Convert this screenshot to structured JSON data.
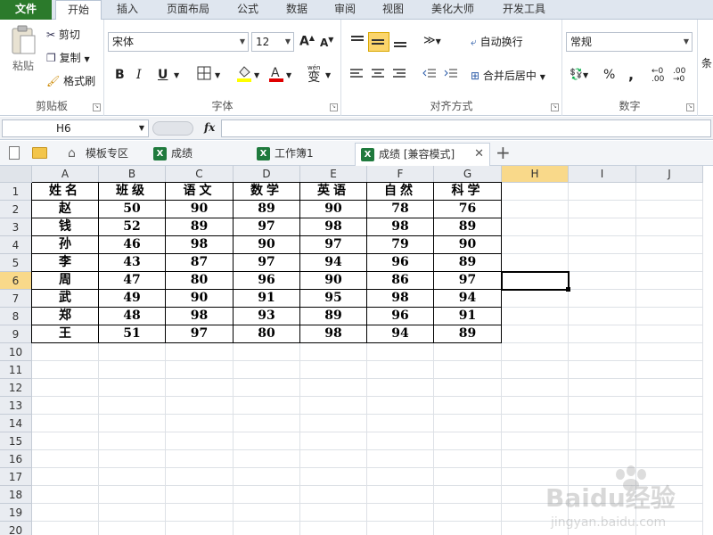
{
  "ribbon_tabs": [
    "文件",
    "开始",
    "插入",
    "页面布局",
    "公式",
    "数据",
    "审阅",
    "视图",
    "美化大师",
    "开发工具"
  ],
  "clipboard": {
    "paste": "粘贴",
    "cut": "剪切",
    "copy": "复制",
    "format_painter": "格式刷",
    "label": "剪贴板"
  },
  "font": {
    "name": "宋体",
    "size": "12",
    "bold": "B",
    "italic": "I",
    "underline": "U",
    "grow": "A",
    "shrink": "A",
    "label": "字体",
    "phonetic": "wén"
  },
  "alignment": {
    "wrap": "自动换行",
    "merge": "合并后居中",
    "label": "对齐方式"
  },
  "number": {
    "format": "常规",
    "percent": "%",
    "comma": ",",
    "label": "数字"
  },
  "styles": {
    "label": "条"
  },
  "formula_bar": {
    "cell_ref": "H6",
    "fx": "fx"
  },
  "workbook_tabs": [
    "模板专区",
    "成绩",
    "工作簿1",
    "成绩 [兼容模式]"
  ],
  "add_tab": "+",
  "close_tab": "✕",
  "columns": [
    "A",
    "B",
    "C",
    "D",
    "E",
    "F",
    "G",
    "H",
    "I",
    "J"
  ],
  "rows": [
    "1",
    "2",
    "3",
    "4",
    "5",
    "6",
    "7",
    "8",
    "9",
    "10",
    "11",
    "12",
    "13",
    "14",
    "15",
    "16",
    "17",
    "18",
    "19",
    "20"
  ],
  "table": {
    "header": [
      "姓名",
      "班级",
      "语文",
      "数学",
      "英语",
      "自然",
      "科学"
    ],
    "body": [
      [
        "赵",
        "50",
        "90",
        "89",
        "90",
        "78",
        "76"
      ],
      [
        "钱",
        "52",
        "89",
        "97",
        "98",
        "98",
        "89"
      ],
      [
        "孙",
        "46",
        "98",
        "90",
        "97",
        "79",
        "90"
      ],
      [
        "李",
        "43",
        "87",
        "97",
        "94",
        "96",
        "89"
      ],
      [
        "周",
        "47",
        "80",
        "96",
        "90",
        "86",
        "97"
      ],
      [
        "武",
        "49",
        "90",
        "91",
        "95",
        "98",
        "94"
      ],
      [
        "郑",
        "48",
        "98",
        "93",
        "89",
        "96",
        "91"
      ],
      [
        "王",
        "51",
        "97",
        "80",
        "98",
        "94",
        "89"
      ]
    ]
  },
  "selected": {
    "column": "H",
    "row": "6"
  },
  "watermark": {
    "logo": "Baidu经验",
    "url": "jingyan.baidu.com"
  },
  "colors": {
    "file_tab": "#2b7a2b",
    "selection_header": "#f9d98a",
    "excel_icon": "#1f7a3d"
  }
}
